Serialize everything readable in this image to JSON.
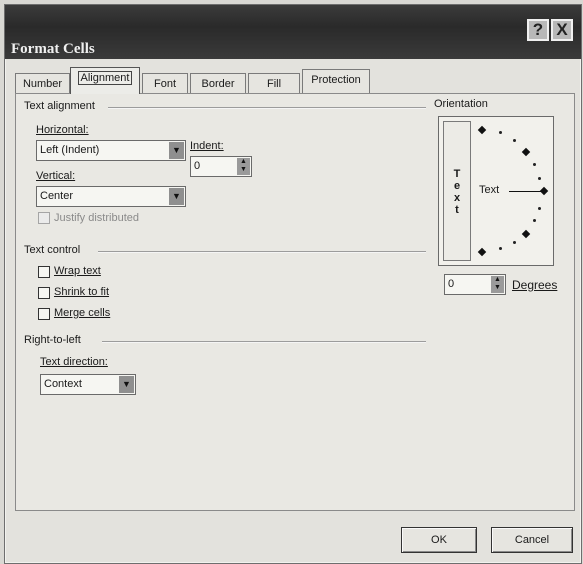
{
  "window": {
    "title": "Format Cells",
    "help_glyph": "?",
    "close_glyph": "X"
  },
  "tabs": [
    {
      "label": "Number"
    },
    {
      "label": "Alignment",
      "active": true
    },
    {
      "label": "Font"
    },
    {
      "label": "Border"
    },
    {
      "label": "Fill"
    },
    {
      "label": "Protection"
    }
  ],
  "text_alignment": {
    "group_label": "Text alignment",
    "horizontal_label": "Horizontal:",
    "horizontal_value": "Left (Indent)",
    "indent_label": "Indent:",
    "indent_value": "0",
    "vertical_label": "Vertical:",
    "vertical_value": "Center",
    "justify_distributed_label": "Justify distributed"
  },
  "text_control": {
    "group_label": "Text control",
    "wrap_text_label": "Wrap text",
    "shrink_to_fit_label": "Shrink to fit",
    "merge_cells_label": "Merge cells"
  },
  "right_to_left": {
    "group_label": "Right-to-left",
    "text_direction_label": "Text direction:",
    "text_direction_value": "Context"
  },
  "orientation": {
    "group_label": "Orientation",
    "vertical_text": [
      "T",
      "e",
      "x",
      "t"
    ],
    "dial_text": "Text",
    "degrees_value": "0",
    "degrees_label": "Degrees"
  },
  "buttons": {
    "ok_label": "OK",
    "cancel_label": "Cancel"
  },
  "icons": {
    "dropdown": "chevron-down-icon",
    "spinner": "spin-up-down-icon"
  }
}
